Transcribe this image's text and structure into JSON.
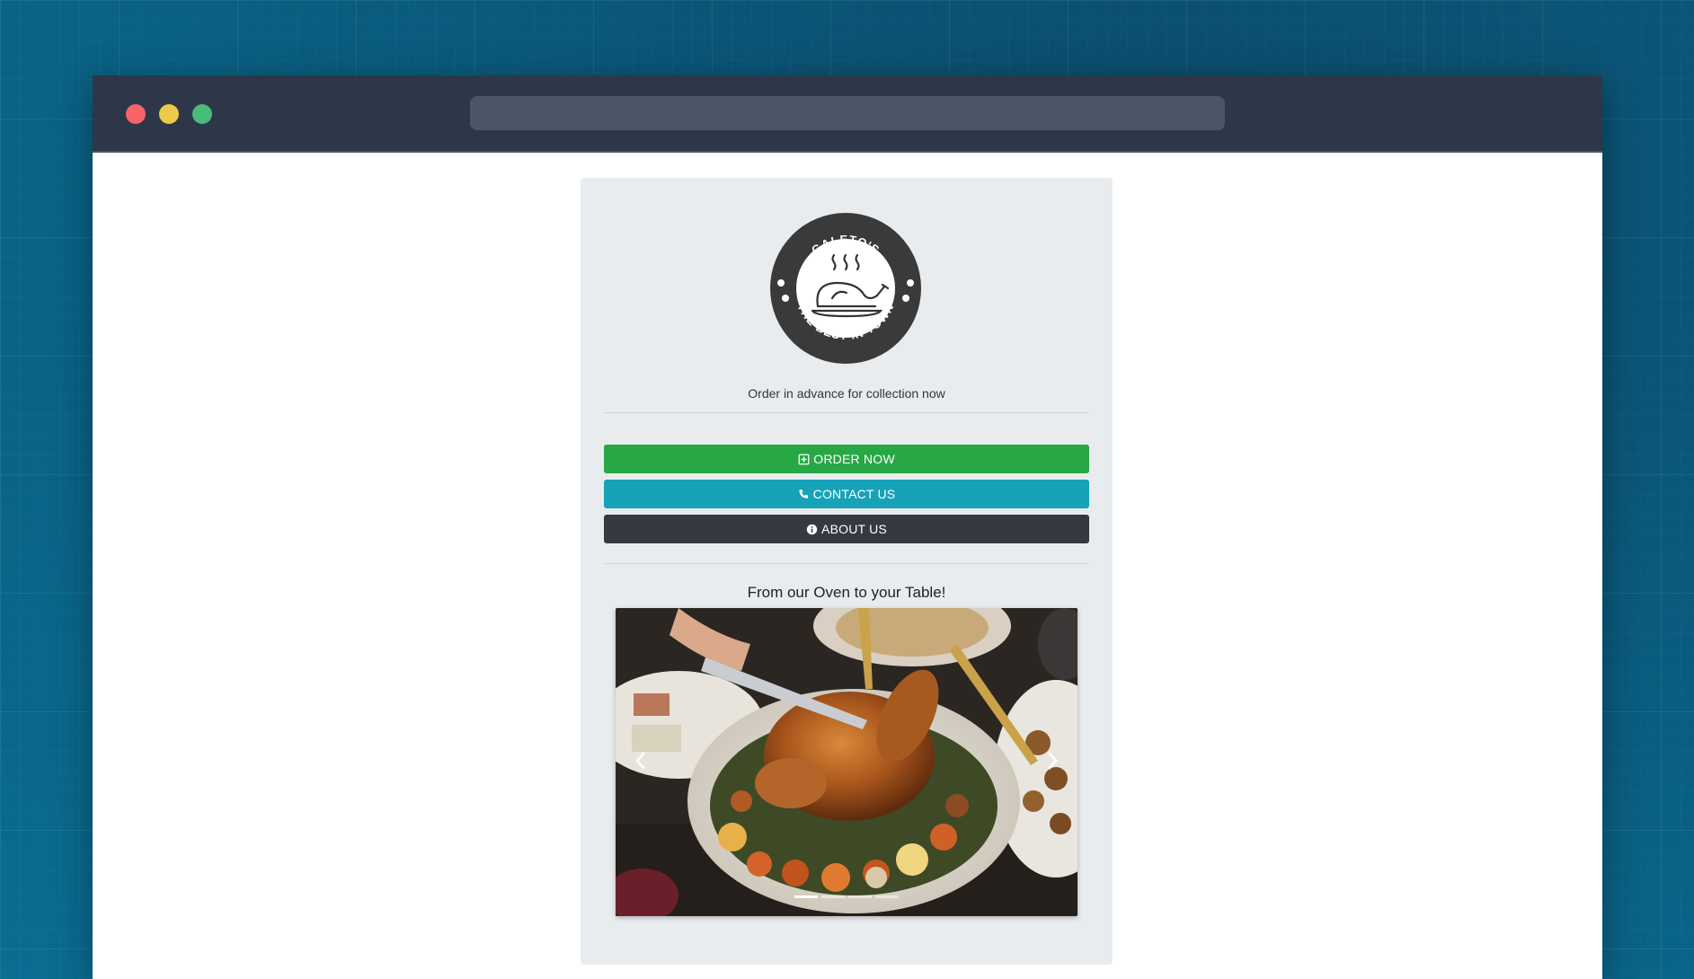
{
  "browser": {
    "url": ""
  },
  "brand": {
    "name": "GALETO'S",
    "slogan": "THE BEST IN TOWN"
  },
  "tagline": "Order in advance for collection now",
  "buttons": {
    "order": "ORDER NOW",
    "contact": "CONTACT US",
    "about": "ABOUT US"
  },
  "icons": {
    "order": "plus-square-icon",
    "contact": "phone-icon",
    "about": "info-circle-icon"
  },
  "colors": {
    "order": "#28a745",
    "contact": "#17a2b8",
    "about": "#343a40"
  },
  "carousel": {
    "title": "From our Oven to your Table!",
    "active_slide": 1,
    "slide_count": 4
  }
}
